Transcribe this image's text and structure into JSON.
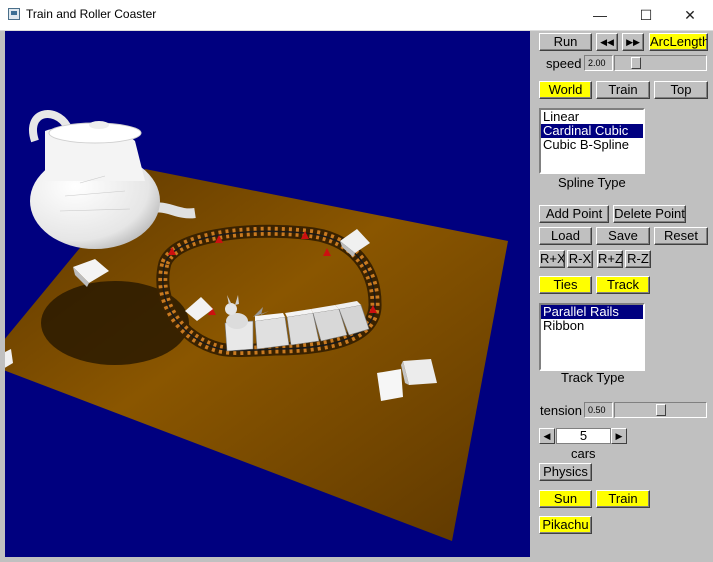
{
  "window": {
    "title": "Train and Roller Coaster",
    "minimize": "—",
    "maximize": "☐",
    "close": "✕"
  },
  "playback": {
    "run_label": "Run",
    "rewind_label": "◀◀",
    "forward_label": "▶▶",
    "arclength_label": "ArcLength"
  },
  "speed": {
    "label": "speed",
    "value": "2.00",
    "fraction": 0.2
  },
  "views": {
    "world": "World",
    "train": "Train",
    "top": "Top"
  },
  "spline": {
    "options": [
      "Linear",
      "Cardinal Cubic",
      "Cubic B-Spline"
    ],
    "selected": 1,
    "caption": "Spline Type"
  },
  "points": {
    "add": "Add Point",
    "delete": "Delete Point",
    "load": "Load",
    "save": "Save",
    "reset": "Reset",
    "rx_plus": "R+X",
    "rx_minus": "R-X",
    "rz_plus": "R+Z",
    "rz_minus": "R-Z"
  },
  "toggles": {
    "ties": "Ties",
    "track": "Track"
  },
  "track": {
    "options": [
      "Parallel Rails",
      "Ribbon"
    ],
    "selected": 0,
    "caption": "Track Type"
  },
  "tension": {
    "label": "tension",
    "value": "0.50",
    "fraction": 0.5
  },
  "cars": {
    "value": "5",
    "label": "cars",
    "left_arrow": "◀",
    "right_arrow": "▶"
  },
  "extras": {
    "physics": "Physics",
    "sun": "Sun",
    "train": "Train",
    "pikachu": "Pikachu"
  },
  "colors": {
    "highlight": "#ffff00",
    "panel": "#c0c0c0",
    "viewport_bg": "#00007f",
    "ground": "#7a4a00",
    "selection": "#000080"
  }
}
